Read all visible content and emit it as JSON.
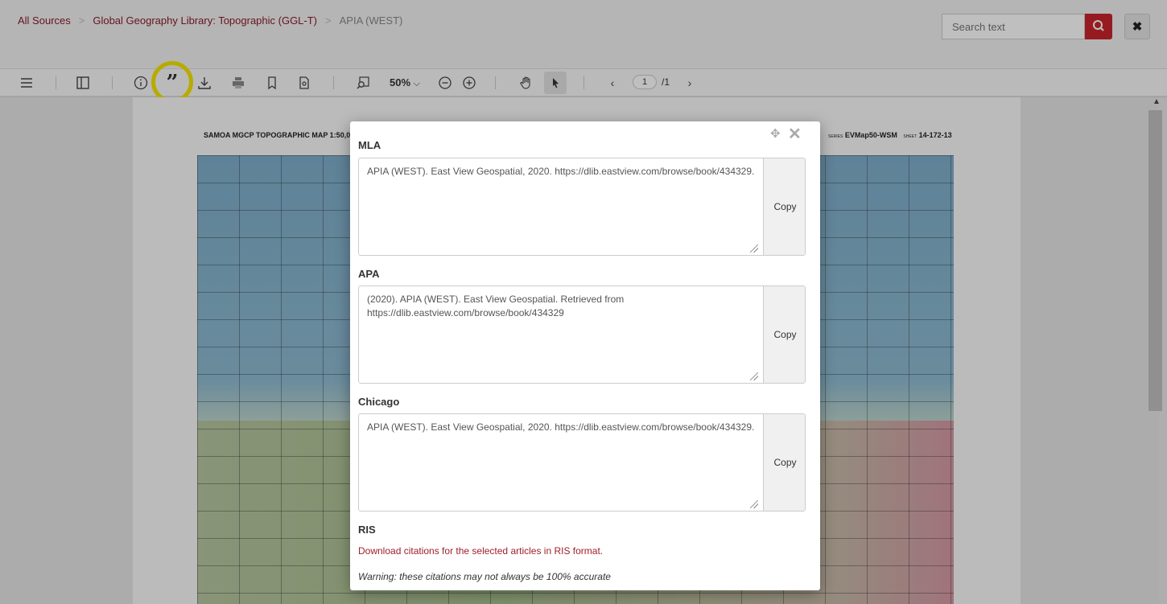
{
  "header": {
    "breadcrumb": [
      "All Sources",
      "Global Geography Library: Topographic (GGL-T)",
      "APIA (WEST)"
    ],
    "search_placeholder": "Search text"
  },
  "toolbar": {
    "zoom": "50%",
    "page_current": "1",
    "page_total": "/1"
  },
  "map": {
    "header_left": "SAMOA  MGCP TOPOGRAPHIC MAP  1:50,0",
    "header_right_series_prefix": "SERIES",
    "header_right_series": "EVMap50-WSM",
    "header_right_sheet_prefix": "SHEET",
    "header_right_sheet": "14-172-13"
  },
  "modal": {
    "sections": [
      {
        "label": "MLA",
        "text": "APIA (WEST). East View Geospatial, 2020. https://dlib.eastview.com/browse/book/434329.",
        "copy": "Copy"
      },
      {
        "label": "APA",
        "text": "(2020). APIA (WEST). East View Geospatial. Retrieved from https://dlib.eastview.com/browse/book/434329",
        "copy": "Copy"
      },
      {
        "label": "Chicago",
        "text": "APIA (WEST). East View Geospatial, 2020. https://dlib.eastview.com/browse/book/434329.",
        "copy": "Copy"
      }
    ],
    "ris_label": "RIS",
    "ris_link": "Download citations for the selected articles in RIS format.",
    "warning": "Warning: these citations may not always be 100% accurate"
  },
  "colors": {
    "accent": "#c9242b",
    "link": "#a0202b",
    "highlight": "#f5e400"
  }
}
